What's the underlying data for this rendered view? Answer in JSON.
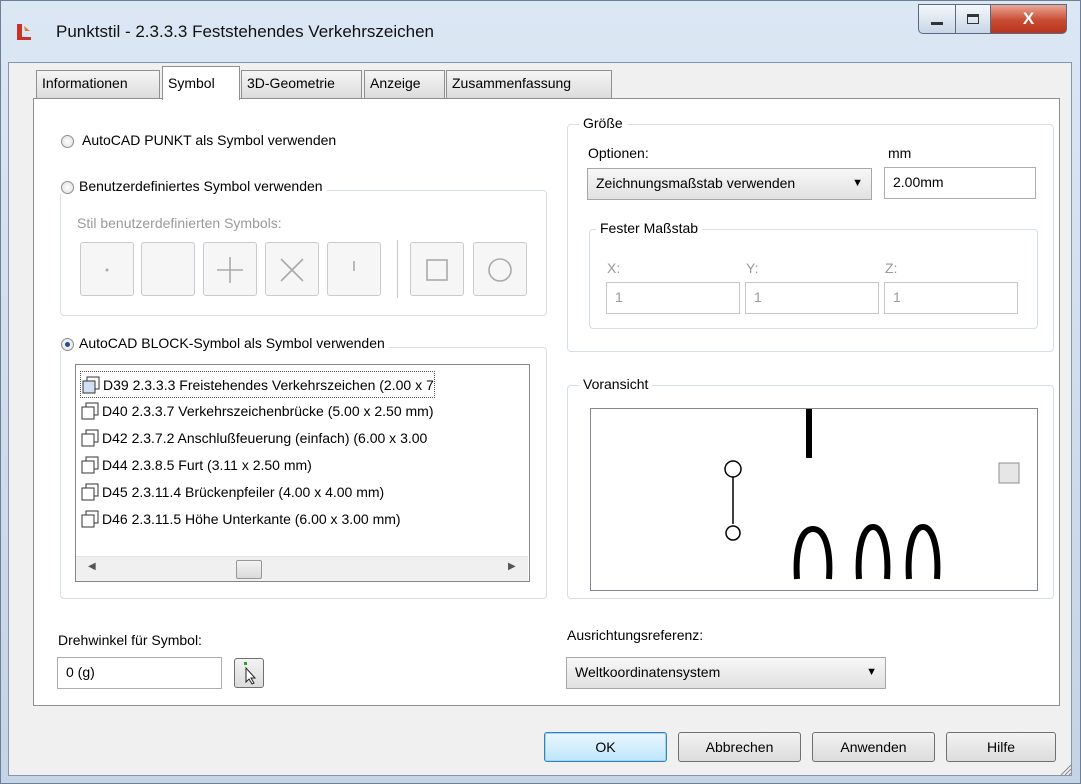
{
  "window": {
    "title": "Punktstil - 2.3.3.3 Feststehendes Verkehrszeichen",
    "close_glyph": "X"
  },
  "tabs": [
    {
      "label": "Informationen"
    },
    {
      "label": "Symbol"
    },
    {
      "label": "3D-Geometrie"
    },
    {
      "label": "Anzeige"
    },
    {
      "label": "Zusammenfassung"
    }
  ],
  "symbol": {
    "radio_point": "AutoCAD PUNKT als Symbol verwenden",
    "radio_custom": "Benutzerdefiniertes Symbol verwenden",
    "custom_style_label": "Stil benutzerdefinierten Symbols:",
    "radio_block": "AutoCAD BLOCK-Symbol als Symbol verwenden",
    "selected_option": "block",
    "blocks": [
      {
        "label": "D39  2.3.3.3 Freistehendes Verkehrszeichen (2.00 x 7"
      },
      {
        "label": "D40  2.3.3.7 Verkehrszeichenbrücke (5.00 x 2.50 mm)"
      },
      {
        "label": "D42  2.3.7.2 Anschlußfeuerung (einfach) (6.00 x 3.00"
      },
      {
        "label": "D44  2.3.8.5 Furt (3.11 x 2.50 mm)"
      },
      {
        "label": "D45  2.3.11.4 Brückenpfeiler (4.00 x 4.00 mm)"
      },
      {
        "label": "D46  2.3.11.5 Höhe Unterkante (6.00 x 3.00 mm)"
      }
    ],
    "rotation_label": "Drehwinkel für Symbol:",
    "rotation_value": "0 (g)"
  },
  "size": {
    "group_label": "Größe",
    "options_label": "Optionen:",
    "options_value": "Zeichnungsmaßstab verwenden",
    "unit_label": "mm",
    "size_value": "2.00mm",
    "fixed_scale_label": "Fester Maßstab",
    "x_label": "X:",
    "x_value": "1",
    "y_label": "Y:",
    "y_value": "1",
    "z_label": "Z:",
    "z_value": "1"
  },
  "preview": {
    "label": "Voransicht"
  },
  "orientation": {
    "label": "Ausrichtungsreferenz:",
    "value": "Weltkoordinatensystem"
  },
  "buttons": {
    "ok": "OK",
    "cancel": "Abbrechen",
    "apply": "Anwenden",
    "help": "Hilfe"
  }
}
